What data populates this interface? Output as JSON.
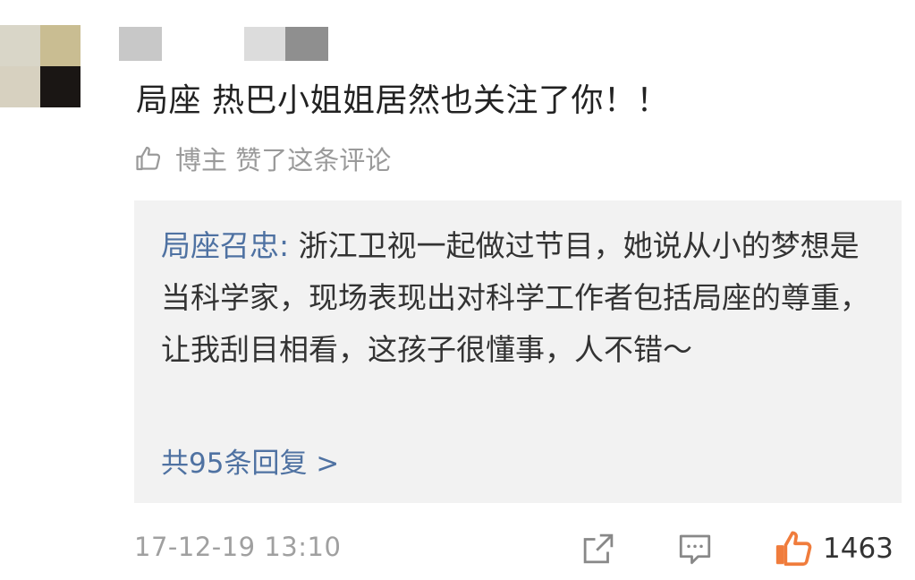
{
  "comment": {
    "text": "局座 热巴小姐姐居然也关注了你！！",
    "liked_by_author": "博主 赞了这条评论",
    "timestamp": "17-12-19 13:10",
    "like_count": "1463"
  },
  "reply": {
    "author": "局座召忠:",
    "text": " 浙江卫视一起做过节目，她说从小的梦想是当科学家，现场表现出对科学工作者包括局座的尊重，让我刮目相看，这孩子很懂事，人不错～",
    "count_label": "共95条回复 >"
  },
  "icons": {
    "thumb": "thumbs-up-outline-icon",
    "share": "share-icon",
    "comment": "comment-icon",
    "like": "thumbs-up-filled-icon"
  },
  "colors": {
    "link_blue": "#4f72a2",
    "like_orange": "#f07c3c",
    "muted_gray": "#9a9a9a"
  }
}
